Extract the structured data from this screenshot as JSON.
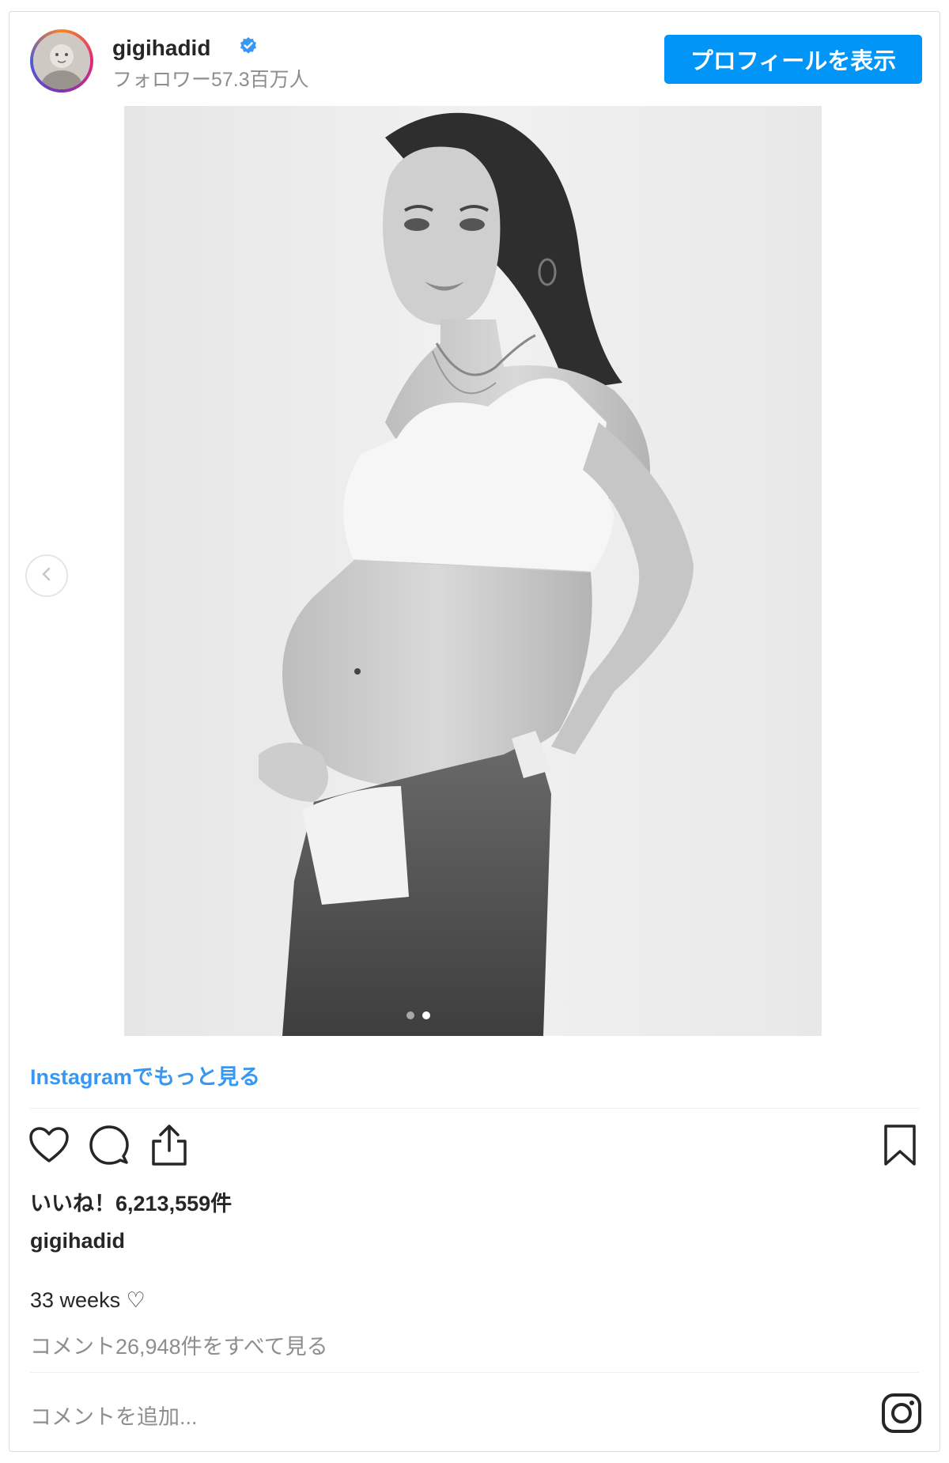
{
  "header": {
    "username": "gigihadid",
    "followers": "フォロワー57.3百万人",
    "profile_button": "プロフィールを表示"
  },
  "post": {
    "more_link": "Instagramでもっと見る",
    "likes": "いいね！6,213,559件",
    "caption_user": "gigihadid",
    "caption_text": "33 weeks ♡",
    "view_comments": "コメント26,948件をすべて見る",
    "comment_placeholder": "コメントを追加..."
  },
  "carousel": {
    "dots_total": 2,
    "active_dot": 2
  },
  "colors": {
    "accent": "#0095f6",
    "link": "#3897f0",
    "muted": "#8e8e8e",
    "text": "#262626"
  },
  "icons": [
    "verified-badge-icon",
    "chevron-left-icon",
    "heart-icon",
    "comment-icon",
    "share-icon",
    "bookmark-icon",
    "instagram-icon"
  ]
}
